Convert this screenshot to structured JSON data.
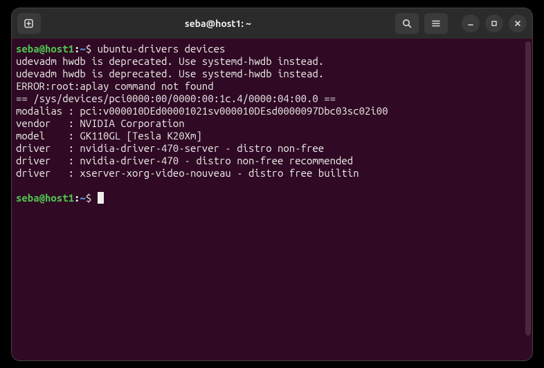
{
  "titlebar": {
    "title": "seba@host1: ~"
  },
  "prompt": {
    "user_host": "seba@host1",
    "path": "~",
    "symbol": "$"
  },
  "command": "ubuntu-drivers devices",
  "output_lines": [
    "udevadm hwdb is deprecated. Use systemd-hwdb instead.",
    "udevadm hwdb is deprecated. Use systemd-hwdb instead.",
    "ERROR:root:aplay command not found",
    "== /sys/devices/pci0000:00/0000:00:1c.4/0000:04:00.0 ==",
    "modalias : pci:v000010DEd00001021sv000010DEsd0000097Dbc03sc02i00",
    "vendor   : NVIDIA Corporation",
    "model    : GK110GL [Tesla K20Xm]",
    "driver   : nvidia-driver-470-server - distro non-free",
    "driver   : nvidia-driver-470 - distro non-free recommended",
    "driver   : xserver-xorg-video-nouveau - distro free builtin"
  ]
}
